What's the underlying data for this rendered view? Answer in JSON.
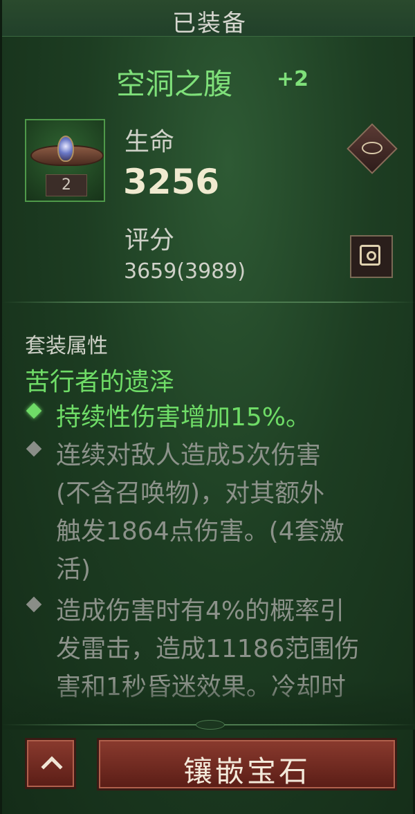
{
  "header": {
    "title": "已装备"
  },
  "item": {
    "name": "空洞之腹",
    "upgrade": "+2",
    "level": "2",
    "stat_label": "生命",
    "stat_value": "3256",
    "score_label": "评分",
    "score_value": "3659(3989)"
  },
  "set": {
    "heading": "套装属性",
    "name": "苦行者的遗泽",
    "bonus1": {
      "active": true,
      "lines": [
        "持续性伤害增加15%。"
      ]
    },
    "bonus2": {
      "active": false,
      "lines": [
        "连续对敌人造成5次伤害",
        "(不含召唤物)，对其额外",
        "触发1864点伤害。(4套激",
        "活)"
      ]
    },
    "bonus3": {
      "active": false,
      "lines": [
        "造成伤害时有4%的概率引",
        "发雷击，造成11186范围伤",
        "害和1秒昏迷效果。冷却时"
      ]
    }
  },
  "buttons": {
    "socket_label": "镶嵌宝石"
  },
  "colors": {
    "active_text": "#6fdc67",
    "inactive_text": "#8c928a",
    "button_red": "#7a2e24"
  }
}
